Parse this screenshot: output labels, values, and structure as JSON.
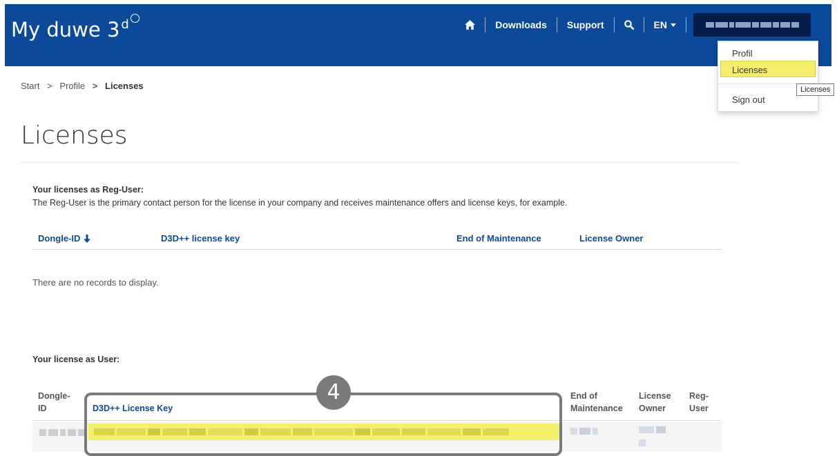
{
  "header": {
    "brand": "My duwe 3",
    "brand_sup": "d",
    "nav": {
      "downloads": "Downloads",
      "support": "Support",
      "language": "EN"
    }
  },
  "breadcrumb": {
    "start": "Start",
    "sep": ">",
    "profile": "Profile",
    "current": "Licenses"
  },
  "page": {
    "title": "Licenses",
    "reg_user": {
      "heading": "Your licenses as Reg-User:",
      "description": "The Reg-User is the primary contact person for the license in your company and receives maintenance offers and license keys, for example.",
      "columns": [
        "Dongle-ID",
        "D3D++ license key",
        "End of Maintenance",
        "License Owner"
      ],
      "empty_message": "There are no records to display."
    },
    "user": {
      "heading": "Your license as User:",
      "columns": {
        "dongle_line1": "Dongle-",
        "dongle_line2": "ID",
        "key": "D3D++ License Key",
        "eom_line1": "End of",
        "eom_line2": "Maintenance",
        "owner_line1": "License",
        "owner_line2": "Owner",
        "reg_line1": "Reg-",
        "reg_line2": "User"
      }
    },
    "callout_number": "4"
  },
  "dropdown": {
    "profile": "Profil",
    "licenses": "Licenses",
    "sign_out": "Sign out",
    "tooltip": "Licenses"
  },
  "colors": {
    "header_bg": "#0b4a9b",
    "link": "#0b4a9b",
    "highlight": "#f3f16a",
    "callout": "#7a7a7a"
  }
}
